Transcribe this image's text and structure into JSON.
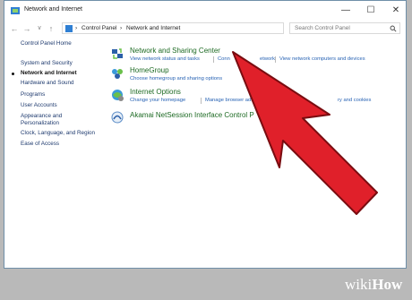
{
  "window": {
    "title": "Network and Internet",
    "minimize": "—",
    "maximize": "☐",
    "close": "✕"
  },
  "nav": {
    "back": "←",
    "forward": "→",
    "dropdown": "∨",
    "up": "↑",
    "breadcrumbs": [
      "Control Panel",
      "Network and Internet"
    ],
    "separator": "›",
    "search_placeholder": "Search Control Panel"
  },
  "sidebar": {
    "items": [
      {
        "label": "Control Panel Home",
        "active": false
      },
      {
        "label": "System and Security",
        "active": false
      },
      {
        "label": "Network and Internet",
        "active": true
      },
      {
        "label": "Hardware and Sound",
        "active": false
      },
      {
        "label": "Programs",
        "active": false
      },
      {
        "label": "User Accounts",
        "active": false
      },
      {
        "label": "Appearance and",
        "active": false
      },
      {
        "label": "Personalization",
        "active": false
      },
      {
        "label": "Clock, Language, and Region",
        "active": false
      },
      {
        "label": "Ease of Access",
        "active": false
      }
    ]
  },
  "categories": [
    {
      "title": "Network and Sharing Center",
      "icon": "network-sharing-icon",
      "links": [
        "View network status and tasks",
        "Conn",
        "etwork",
        "View network computers and devices"
      ]
    },
    {
      "title": "HomeGroup",
      "icon": "homegroup-icon",
      "links": [
        "Choose homegroup and sharing options"
      ]
    },
    {
      "title": "Internet Options",
      "icon": "internet-options-icon",
      "links": [
        "Change your homepage",
        "Manage browser add",
        "ry and cookies"
      ]
    },
    {
      "title": "Akamai NetSession Interface Control P",
      "icon": "akamai-icon",
      "links": []
    }
  ],
  "watermark": {
    "part1": "wiki",
    "part2": "How"
  },
  "colors": {
    "arrow": "#e0202a",
    "link": "#2863b4",
    "title": "#1d6a23"
  }
}
